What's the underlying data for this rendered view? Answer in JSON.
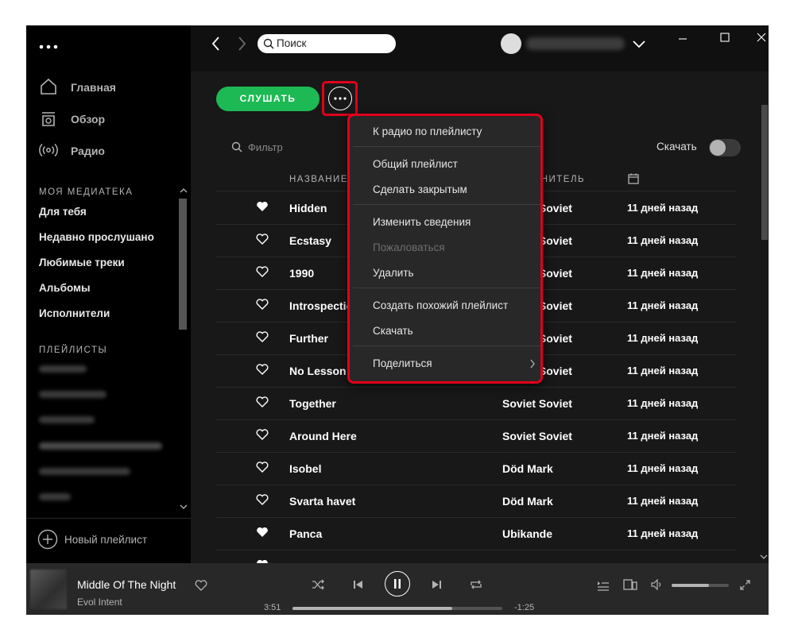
{
  "window": {
    "controls": [
      "minimize",
      "maximize",
      "close"
    ]
  },
  "sidebar": {
    "nav": [
      {
        "label": "Главная",
        "icon": "home-icon"
      },
      {
        "label": "Обзор",
        "icon": "browse-icon"
      },
      {
        "label": "Радио",
        "icon": "radio-icon"
      }
    ],
    "library_header": "МОЯ МЕДИАТЕКА",
    "library": [
      "Для тебя",
      "Недавно прослушано",
      "Любимые треки",
      "Альбомы",
      "Исполнители"
    ],
    "playlists_header": "ПЛЕЙЛИСТЫ",
    "new_playlist_label": "Новый плейлист"
  },
  "topbar": {
    "search_placeholder": "Поиск"
  },
  "playlist": {
    "play_button_label": "СЛУШАТЬ",
    "filter_placeholder": "Фильтр",
    "download_label": "Скачать",
    "columns": {
      "title": "НАЗВАНИЕ",
      "artist": "ИСПОЛНИТЕЛЬ"
    },
    "tracks": [
      {
        "title": "Hidden",
        "artist": "Soviet Soviet",
        "date": "11 дней назад",
        "liked": true
      },
      {
        "title": "Ecstasy",
        "artist": "Soviet Soviet",
        "date": "11 дней назад",
        "liked": false
      },
      {
        "title": "1990",
        "artist": "Soviet Soviet",
        "date": "11 дней назад",
        "liked": false
      },
      {
        "title": "Introspection",
        "artist": "Soviet Soviet",
        "date": "11 дней назад",
        "liked": false
      },
      {
        "title": "Further",
        "artist": "Soviet Soviet",
        "date": "11 дней назад",
        "liked": false
      },
      {
        "title": "No Lesson",
        "artist": "Soviet Soviet",
        "date": "11 дней назад",
        "liked": false
      },
      {
        "title": "Together",
        "artist": "Soviet Soviet",
        "date": "11 дней назад",
        "liked": false
      },
      {
        "title": "Around Here",
        "artist": "Soviet Soviet",
        "date": "11 дней назад",
        "liked": false
      },
      {
        "title": "Isobel",
        "artist": "Död Mark",
        "date": "11 дней назад",
        "liked": false
      },
      {
        "title": "Svarta havet",
        "artist": "Död Mark",
        "date": "11 дней назад",
        "liked": false
      },
      {
        "title": "Panca",
        "artist": "Ubikande",
        "date": "11 дней назад",
        "liked": true
      }
    ]
  },
  "context_menu": {
    "items": [
      {
        "label": "К радио по плейлисту",
        "enabled": true
      },
      {
        "label": "Общий плейлист",
        "enabled": true
      },
      {
        "label": "Сделать закрытым",
        "enabled": true
      },
      {
        "label": "Изменить сведения",
        "enabled": true
      },
      {
        "label": "Пожаловаться",
        "enabled": false
      },
      {
        "label": "Удалить",
        "enabled": true
      },
      {
        "label": "Создать похожий плейлист",
        "enabled": true
      },
      {
        "label": "Скачать",
        "enabled": true
      },
      {
        "label": "Поделиться",
        "enabled": true,
        "submenu": true
      }
    ]
  },
  "player": {
    "track_title": "Middle Of The Night",
    "artist": "Evol Intent",
    "elapsed": "3:51",
    "remaining": "-1:25",
    "progress_fraction": 0.76,
    "volume_fraction": 0.65
  },
  "colors": {
    "accent": "#1db954",
    "highlight": "#e0001b",
    "background": "#181818"
  }
}
